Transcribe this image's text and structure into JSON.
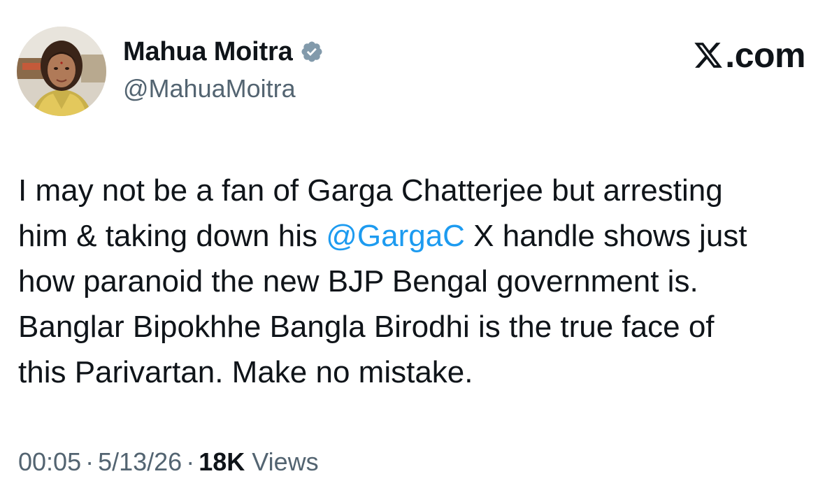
{
  "author": {
    "display_name": "Mahua Moitra",
    "handle": "@MahuaMoitra"
  },
  "brand": {
    "label": ".com",
    "icon": "x-logo-icon"
  },
  "tweet": {
    "line1": "I may not be a fan of Garga Chatterjee but arresting",
    "line2_before": "him & taking down his ",
    "line2_mention": "@GargaC",
    "line2_after": " X handle shows just",
    "line3": "how paranoid the new BJP Bengal government is.",
    "line4": "Banglar Bipokhhe Bangla Birodhi is the true face of",
    "line5": "this Parivartan. Make no mistake."
  },
  "meta": {
    "time": "00:05",
    "separator": "·",
    "date": "5/13/26",
    "views_count": "18K",
    "views_label": "Views"
  },
  "colors": {
    "text": "#0f1419",
    "secondary": "#536471",
    "link": "#1d9bf0",
    "verified_badge": "#829aab"
  }
}
